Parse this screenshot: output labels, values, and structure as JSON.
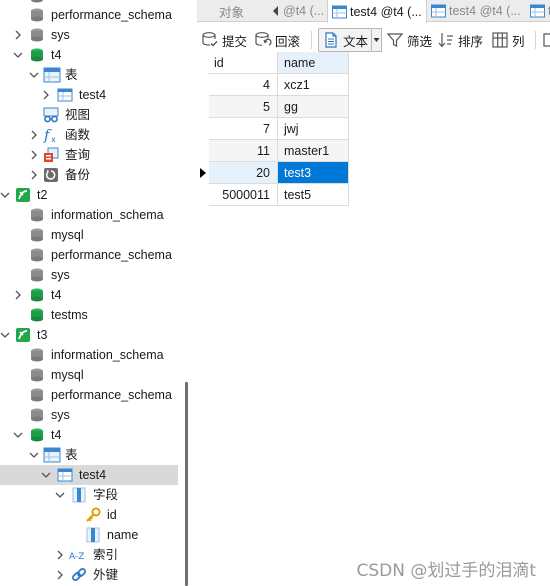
{
  "nav": {
    "items": [
      {
        "label": "performance_schema",
        "kind": "db-gray"
      },
      {
        "label": "sys",
        "kind": "db-gray"
      },
      {
        "label": "t4",
        "kind": "db-green"
      },
      {
        "label": "表",
        "kind": "tables-folder"
      },
      {
        "label": "test4",
        "kind": "table"
      },
      {
        "label": "视图",
        "kind": "views"
      },
      {
        "label": "函数",
        "kind": "functions"
      },
      {
        "label": "查询",
        "kind": "queries"
      },
      {
        "label": "备份",
        "kind": "backups"
      },
      {
        "label": "t2",
        "kind": "connection"
      },
      {
        "label": "information_schema",
        "kind": "db-gray"
      },
      {
        "label": "mysql",
        "kind": "db-gray"
      },
      {
        "label": "performance_schema",
        "kind": "db-gray"
      },
      {
        "label": "sys",
        "kind": "db-gray"
      },
      {
        "label": "t4",
        "kind": "db-green"
      },
      {
        "label": "testms",
        "kind": "db-green"
      },
      {
        "label": "t3",
        "kind": "connection"
      },
      {
        "label": "information_schema",
        "kind": "db-gray"
      },
      {
        "label": "mysql",
        "kind": "db-gray"
      },
      {
        "label": "performance_schema",
        "kind": "db-gray"
      },
      {
        "label": "sys",
        "kind": "db-gray"
      },
      {
        "label": "t4",
        "kind": "db-green"
      },
      {
        "label": "表",
        "kind": "tables-folder"
      },
      {
        "label": "test4",
        "kind": "table"
      },
      {
        "label": "字段",
        "kind": "fields"
      },
      {
        "label": "id",
        "kind": "key-field"
      },
      {
        "label": "name",
        "kind": "field"
      },
      {
        "label": "索引",
        "kind": "indexes"
      },
      {
        "label": "外键",
        "kind": "foreign-keys"
      }
    ]
  },
  "tabs": [
    {
      "label": "对象",
      "icon": ""
    },
    {
      "label": "@t4 (...",
      "icon": ""
    },
    {
      "label": "test4 @t4 (...",
      "icon": "table-icon"
    },
    {
      "label": "test4 @t4 (...",
      "icon": "table-icon"
    },
    {
      "label": "te",
      "icon": "table-icon"
    }
  ],
  "toolbar": {
    "commit_label": "提交",
    "rollback_label": "回滚",
    "text_label": "文本",
    "filter_label": "筛选",
    "sort_label": "排序",
    "columns_label": "列"
  },
  "grid": {
    "columns": [
      "id",
      "name"
    ],
    "rows": [
      {
        "id": "4",
        "name": "xcz1"
      },
      {
        "id": "5",
        "name": "gg"
      },
      {
        "id": "7",
        "name": "jwj"
      },
      {
        "id": "11",
        "name": "master1"
      },
      {
        "id": "20",
        "name": "test3"
      },
      {
        "id": "5000011",
        "name": "test5"
      }
    ],
    "current_row_index": 4
  },
  "watermark": "CSDN @划过手的泪滴t",
  "colors": {
    "selection": "#0078d7",
    "db_green": "#1f9e4a",
    "accent_blue": "#2b79c2"
  }
}
